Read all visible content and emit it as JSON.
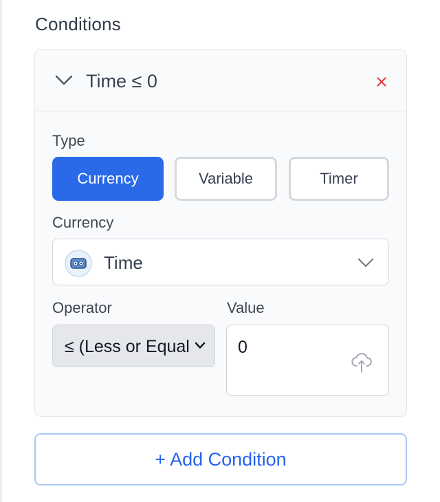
{
  "section": {
    "title": "Conditions"
  },
  "condition": {
    "title": "Time ≤ 0",
    "type_label": "Type",
    "types": [
      {
        "label": "Currency",
        "selected": true
      },
      {
        "label": "Variable",
        "selected": false
      },
      {
        "label": "Timer",
        "selected": false
      }
    ],
    "currency_label": "Currency",
    "currency_value": "Time",
    "operator_label": "Operator",
    "operator_value": "≤ (Less or Equal)",
    "value_label": "Value",
    "value": "0"
  },
  "add_button": {
    "label": "+ Add Condition"
  },
  "colors": {
    "accent": "#2a6ae9",
    "link": "#2563eb",
    "danger": "#e53e3e",
    "border": "#d5d9de"
  },
  "icons": {
    "collapse": "chevron-down-icon",
    "remove": "close-icon",
    "currency": "currency-avatar-icon",
    "dropdown": "chevron-down-icon",
    "upload": "upload-icon"
  }
}
